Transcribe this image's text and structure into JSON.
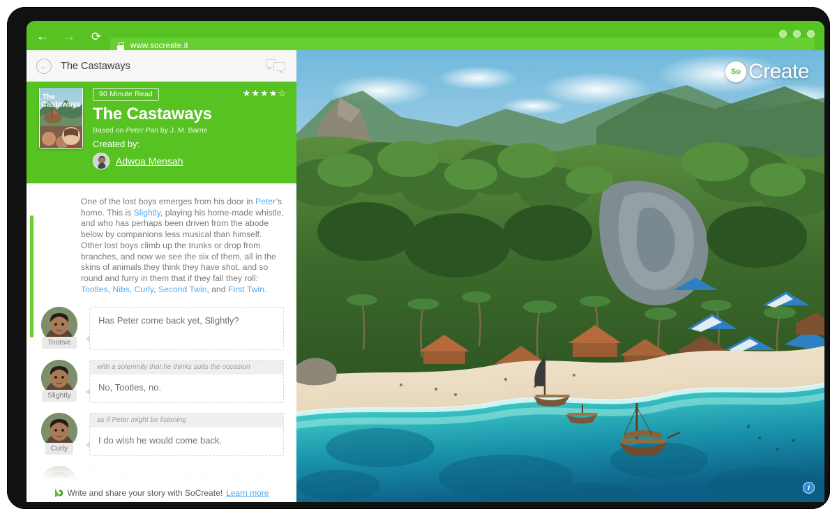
{
  "browser": {
    "back_label": "←",
    "forward_label": "→",
    "reload_label": "⟳",
    "url": "www.socreate.it",
    "lock_icon": "lock-icon"
  },
  "story_header": {
    "back_label": "←",
    "title": "The Castaways",
    "comment_icon": "comment-bubbles-icon"
  },
  "hero": {
    "badge": "90 Minute Read",
    "title": "The Castaways",
    "based_on_prefix": "Based on ",
    "based_on_work": "Peter Pan",
    "based_on_suffix": " by J. M. Barrie",
    "created_by_label": "Created by:",
    "author": "Adwoa Mensah",
    "rating_filled": 4,
    "rating_total": 5,
    "cover_title_line1": "The",
    "cover_title_line2": "Castaways"
  },
  "narrative": {
    "segments": [
      {
        "text": "One of the lost boys emerges from his door in ",
        "link": false
      },
      {
        "text": "Peter",
        "link": true
      },
      {
        "text": "’s home. This is ",
        "link": false
      },
      {
        "text": "Slightly",
        "link": true
      },
      {
        "text": ", playing his home-made whistle, and who has perhaps been driven from the abode below by companions less musical than himself. Other lost boys climb up the trunks or drop from branches, and now we see the six of them, all in the skins of animals they think they have shot, and so round and furry in them that if they fall they roll: ",
        "link": false
      },
      {
        "text": "Tootles",
        "link": true
      },
      {
        "text": ", ",
        "link": false
      },
      {
        "text": "Nibs",
        "link": true
      },
      {
        "text": ", ",
        "link": false
      },
      {
        "text": "Curly",
        "link": true
      },
      {
        "text": ", ",
        "link": false
      },
      {
        "text": "Second Twin",
        "link": true
      },
      {
        "text": ", and ",
        "link": false
      },
      {
        "text": "First Twin",
        "link": true
      },
      {
        "text": ".",
        "link": false
      }
    ]
  },
  "dialogue": [
    {
      "character": "Tootsie",
      "parenthetical": "",
      "line": "Has Peter come back yet, Slightly?",
      "faded": false
    },
    {
      "character": "Slightly",
      "parenthetical": "with a solemnity that he thinks suits the occasion",
      "line": "No, Tootles, no.",
      "faded": false
    },
    {
      "character": "Curly",
      "parenthetical": "as if Peter might be listening",
      "line": "I do wish he would come back.",
      "faded": false
    },
    {
      "character": "",
      "parenthetical": "",
      "line": "I am always afraid of the pirates when Peter is",
      "faded": true
    }
  ],
  "promo": {
    "logo_icon": "socreate-play-icon",
    "text": "Write and share your story with SoCreate!",
    "link_text": "Learn more"
  },
  "photo": {
    "logo_so": "So",
    "logo_create": "Create",
    "info_icon": "info-icon",
    "info_label": "i"
  },
  "colors": {
    "brand_green": "#57c322",
    "url_pill_green": "#67cf32",
    "link_blue": "#56aaf0",
    "info_blue": "#2b8fd6",
    "name_chip": "#e9e9e9"
  }
}
